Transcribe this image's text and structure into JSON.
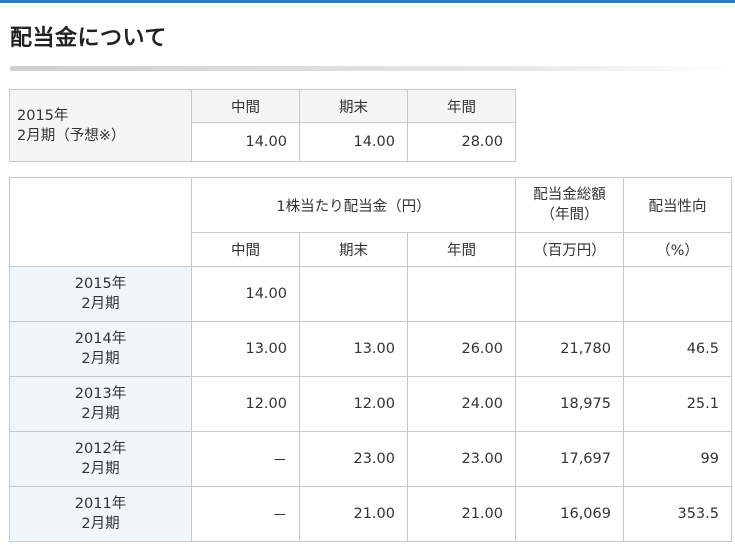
{
  "page": {
    "title": "配当金について",
    "accent": "#1f7fd0",
    "year_cell_bg": "#f0f7fc",
    "header_cell_bg": "#f5f5f5"
  },
  "forecast": {
    "label_line1": "2015年",
    "label_line2": "2月期（予想※）",
    "headers": [
      "中間",
      "期末",
      "年間"
    ],
    "values": [
      "14.00",
      "14.00",
      "28.00"
    ]
  },
  "dividend": {
    "group_header": "1株当たり配当金（円）",
    "total_header_line1": "配当金総額",
    "total_header_line2": "（年間）",
    "payout_header": "配当性向",
    "sub_headers": [
      "中間",
      "期末",
      "年間",
      "（百万円）",
      "（%）"
    ],
    "rows": [
      {
        "year": "2015年",
        "period": "2月期",
        "cells": [
          "14.00",
          "",
          "",
          "",
          ""
        ]
      },
      {
        "year": "2014年",
        "period": "2月期",
        "cells": [
          "13.00",
          "13.00",
          "26.00",
          "21,780",
          "46.5"
        ]
      },
      {
        "year": "2013年",
        "period": "2月期",
        "cells": [
          "12.00",
          "12.00",
          "24.00",
          "18,975",
          "25.1"
        ]
      },
      {
        "year": "2012年",
        "period": "2月期",
        "cells": [
          "－",
          "23.00",
          "23.00",
          "17,697",
          "99"
        ]
      },
      {
        "year": "2011年",
        "period": "2月期",
        "cells": [
          "－",
          "21.00",
          "21.00",
          "16,069",
          "353.5"
        ]
      }
    ]
  }
}
